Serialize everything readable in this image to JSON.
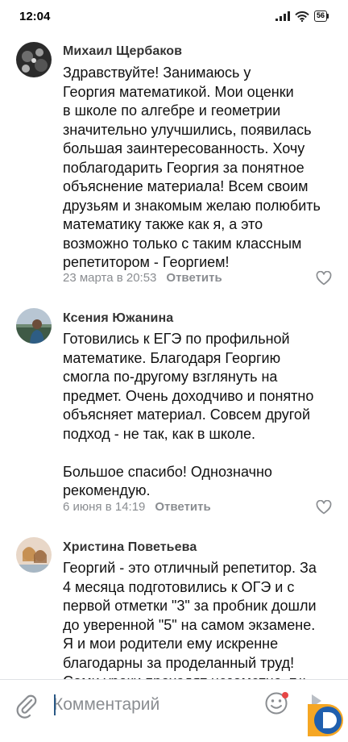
{
  "status_bar": {
    "time": "12:04",
    "battery": "56"
  },
  "comments": [
    {
      "author": "Михаил Щербаков",
      "text": "Здравствуйте! Занимаюсь у\nГеоргия математикой. Мои оценки\nв школе по алгебре и геометрии\nзначительно улучшились, появилась\nбольшая заинтересованность. Хочу\nпоблагодарить Георгия за понятное\nобъяснение материала!  Всем своим\nдрузьям и знакомым желаю полюбить\nматематику также как я, а это\nвозможно только с таким классным\nрепетитором - Георгием!",
      "date": "23 марта в 20:53",
      "reply": "Ответить"
    },
    {
      "author": "Ксения Южанина",
      "text": "Готовились к ЕГЭ по профильной\nматематике. Благодаря Георгию\nсмогла по-другому взглянуть на\nпредмет. Очень доходчиво и понятно\nобъясняет материал. Совсем другой\nподход - не так, как в школе.\n\nБольшое спасибо! Однозначно\nрекомендую.",
      "date": "6 июня в 14:19",
      "reply": "Ответить"
    },
    {
      "author": "Христина Поветьева",
      "text": "Георгий - это отличный репетитор. За\n4 месяца подготовились к ОГЭ и с\nпервой отметки \"3\" за пробник дошли\nдо уверенной \"5\" на самом экзамене.\nЯ и мои родители ему искренне\nблагодарны за проделанный труд!\nСами уроки проходят незаметно, т.к."
    }
  ],
  "composer": {
    "placeholder": "Комментарий"
  },
  "colors": {
    "accent": "#2a5885",
    "meta": "#8a8d91",
    "logo_orange": "#f5a623",
    "logo_blue": "#1f5fae"
  }
}
